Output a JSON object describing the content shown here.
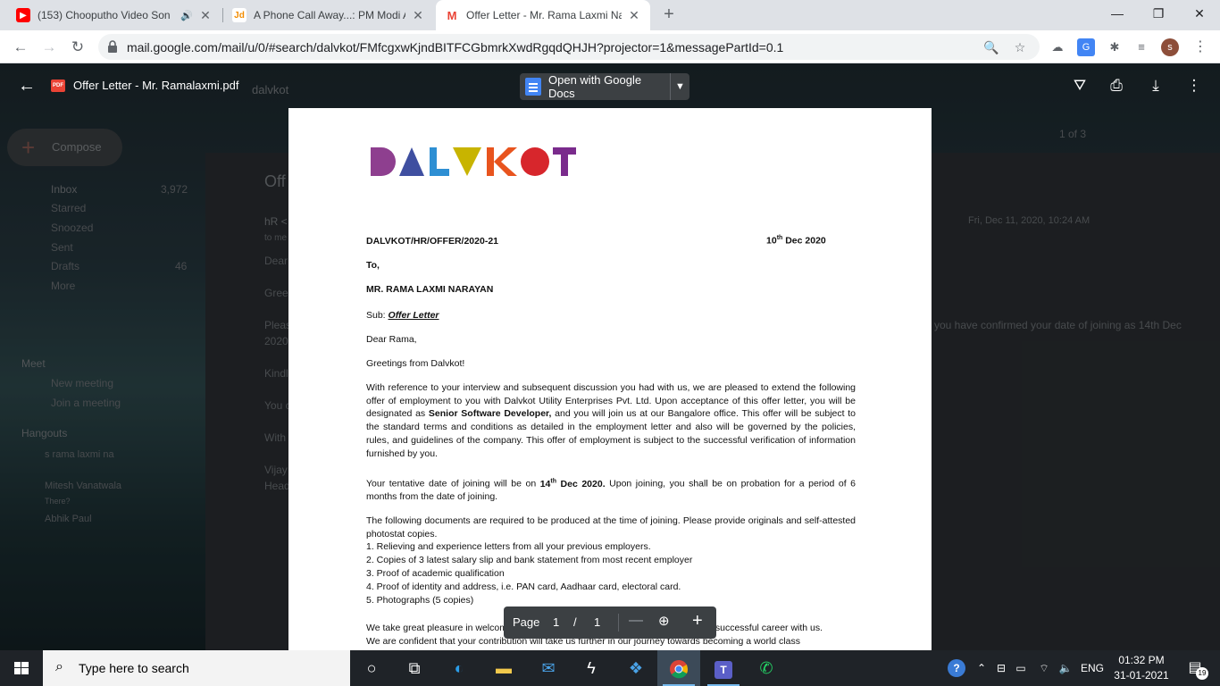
{
  "tabs": [
    {
      "title": "(153) Chooputho Video Son",
      "fav": "yt"
    },
    {
      "title": "A Phone Call Away...: PM Modi At",
      "fav": "jd"
    },
    {
      "title": "Offer Letter - Mr. Rama Laxmi Na",
      "fav": "gm"
    }
  ],
  "url": "mail.google.com/mail/u/0/#search/dalvkot/FMfcgxwKjndBITFCGbmrkXwdRgqdQHJH?projector=1&messagePartId=0.1",
  "profile_initial": "s",
  "pdf": {
    "filename": "Offer Letter - Mr. Ramalaxmi.pdf",
    "open_with": "Open with Google Docs",
    "page_label": "Page",
    "page_current": "1",
    "page_sep": "/",
    "page_total": "1"
  },
  "letter": {
    "ref": "DALVKOT/HR/OFFER/2020-21",
    "date_day": "10",
    "date_sup": "th",
    "date_rest": " Dec 2020",
    "to": "To,",
    "name": "MR. RAMA LAXMI NARAYAN",
    "sub_label": "Sub: ",
    "sub_value": "Offer Letter",
    "salutation": "Dear Rama,",
    "greeting": "Greetings from Dalvkot!",
    "p1_a": "With reference to your interview and subsequent discussion you had with us, we are pleased to extend the following offer of employment to you with Dalvkot Utility Enterprises Pvt. Ltd.  Upon acceptance of this offer letter, you will be designated as ",
    "p1_b": "Senior Software Developer,",
    "p1_c": " and you will join us at our Bangalore office.  This offer will be subject to the standard terms and conditions as detailed in the employment letter and also will be governed by the policies, rules, and guidelines of the company.  This offer of employment is subject to the successful verification of information furnished by you.",
    "p2_a": "Your tentative date of joining will be on ",
    "p2_b": "14",
    "p2_sup": "th",
    "p2_c": " Dec 2020.",
    "p2_d": "  Upon joining, you shall be on probation for a period of 6 months from the date of joining.",
    "p3": "The following documents are required to be produced at the time of joining.  Please provide originals and self-attested photostat copies.",
    "list": [
      "1.  Relieving and experience letters from all your previous employers.",
      "2.  Copies of 3 latest salary slip and bank statement from most recent employer",
      "3.  Proof of academic qualification",
      "4.  Proof of identity and address, i.e. PAN card, Aadhaar card, electoral card.",
      "5.  Photographs (5 copies)"
    ],
    "p4": "We take great pleasure in welcoming you to Dalvkot family and wish you a long and successful career with us.",
    "p5": "We are confident that your contribution will take us further in our journey towards becoming a world class"
  },
  "gmail_bg": {
    "search_text": "dalvkot",
    "compose": "Compose",
    "nav": [
      "Inbox",
      "Starred",
      "Snoozed",
      "Sent",
      "Drafts",
      "More"
    ],
    "inbox_count": "3,972",
    "drafts_count": "46",
    "meet_header": "Meet",
    "meet_items": [
      "New meeting",
      "Join a meeting"
    ],
    "hangouts_header": "Hangouts",
    "hangouts_user": "s rama laxmi na",
    "contacts": [
      "Mitesh Vanatwala",
      "There?",
      "Abhik Paul"
    ],
    "page_count": "1 of 3",
    "subject_stub": "Off",
    "sender_stub": "hR <",
    "to_stub": "to me",
    "date": "Fri, Dec 11, 2020, 10:24 AM",
    "body_stubs": [
      "Dear",
      "Gree",
      "Pleas",
      "2020.",
      "Kindl",
      "You c",
      "With",
      "Vijay",
      "Head"
    ],
    "right_text": "you have confirmed your date of joining as 14th Dec"
  },
  "taskbar": {
    "search_placeholder": "Type here to search",
    "lang": "ENG",
    "time": "01:32 PM",
    "date": "31-01-2021",
    "notif_count": "19"
  },
  "colors": {
    "logo": [
      "#8e3f8f",
      "#3f4fa0",
      "#2e8fd3",
      "#c8b400",
      "#e8541e",
      "#d7262c",
      "#7a2b8c"
    ]
  }
}
